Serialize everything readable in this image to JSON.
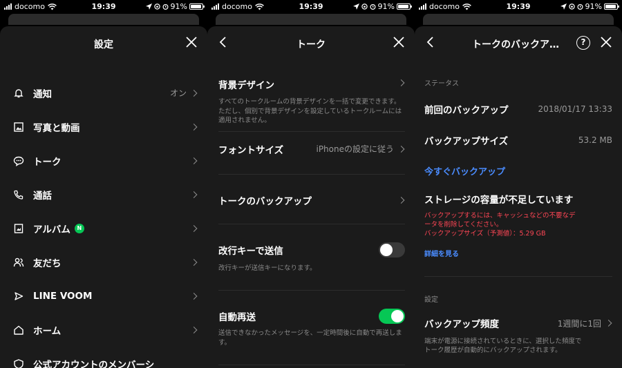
{
  "status": {
    "carrier": "docomo",
    "time": "19:39",
    "battery": "91%"
  },
  "panel1": {
    "title": "設定",
    "items": [
      {
        "label": "通知",
        "value": "オン",
        "icon": "bell-icon"
      },
      {
        "label": "写真と動画",
        "value": "",
        "icon": "photo-icon"
      },
      {
        "label": "トーク",
        "value": "",
        "icon": "chat-bubble-icon"
      },
      {
        "label": "通話",
        "value": "",
        "icon": "phone-icon"
      },
      {
        "label": "アルバム",
        "value": "",
        "icon": "album-icon",
        "badge": "N"
      },
      {
        "label": "友だち",
        "value": "",
        "icon": "friends-icon"
      },
      {
        "label": "LINE VOOM",
        "value": "",
        "icon": "voom-icon"
      },
      {
        "label": "ホーム",
        "value": "",
        "icon": "home-icon"
      },
      {
        "label": "公式アカウントのメンバーシ",
        "value": "",
        "icon": "official-account-icon"
      }
    ]
  },
  "panel2": {
    "title": "トーク",
    "bg_design": {
      "label": "背景デザイン",
      "desc": "すべてのトークルームの背景デザインを一括で変更できます。ただし、個別で背景デザインを設定しているトークルームには適用されません。"
    },
    "font_size": {
      "label": "フォントサイズ",
      "value": "iPhoneの設定に従う"
    },
    "backup": {
      "label": "トークのバックアップ"
    },
    "enter_send": {
      "label": "改行キーで送信",
      "desc": "改行キーが送信キーになります。",
      "enabled": false
    },
    "auto_resend": {
      "label": "自動再送",
      "desc": "送信できなかったメッセージを、一定時間後に自動で再送します。",
      "enabled": true
    }
  },
  "panel3": {
    "title": "トークのバックア…",
    "status_header": "ステータス",
    "last_backup": {
      "label": "前回のバックアップ",
      "value": "2018/01/17 13:33"
    },
    "backup_size": {
      "label": "バックアップサイズ",
      "value": "53.2 MB"
    },
    "backup_now": "今すぐバックアップ",
    "storage_title": "ストレージの容量が不足しています",
    "warn_line1": "バックアップするには、キャッシュなどの不要なデ",
    "warn_line2": "ータを削除してください。",
    "warn_line3": "バックアップサイズ（予測値）：5.29 GB",
    "details_link": "詳細を見る",
    "settings_header": "設定",
    "frequency": {
      "label": "バックアップ頻度",
      "value": "1週間に1回"
    },
    "freq_desc_line1": "端末が電源に接続されているときに、選択した頻度で",
    "freq_desc_line2": "トーク履歴が自動的にバックアップされます。"
  },
  "colors": {
    "accent_green": "#06c755",
    "link_blue": "#4a8cff",
    "warning_red": "#ff4655",
    "sheet_bg": "#1b1b1b"
  }
}
